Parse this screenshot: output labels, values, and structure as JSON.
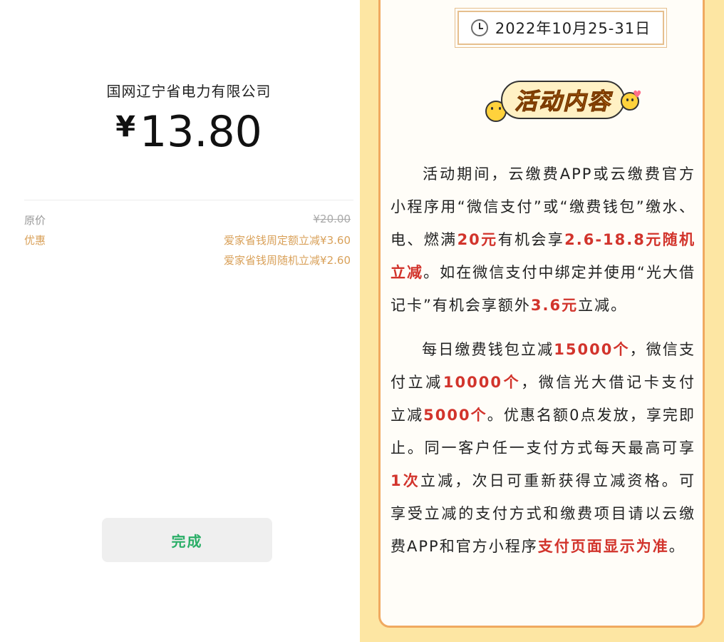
{
  "payment": {
    "merchant": "国网辽宁省电力有限公司",
    "currency_symbol": "¥",
    "amount": "13.80",
    "original_label": "原价",
    "original_value": "¥20.00",
    "discount_label": "优惠",
    "discounts": [
      "爱家省钱周定额立减¥3.60",
      "爱家省钱周随机立减¥2.60"
    ],
    "done_button": "完成"
  },
  "promo": {
    "date": "2022年10月25-31日",
    "badge": "活动内容",
    "p1": {
      "t1": "活动期间，云缴费APP或云缴费官方小程序用“微信支付”或“缴费钱包”缴水、电、燃满",
      "h1": "20元",
      "t2": "有机会享",
      "h2": "2.6-18.8元随机立减",
      "t3": "。如在微信支付中绑定并使用“光大借记卡”有机会享额外",
      "h3": "3.6元",
      "t4": "立减。"
    },
    "p2": {
      "t1": "每日缴费钱包立减",
      "h1": "15000个",
      "t2": "，微信支付立减",
      "h2": "10000个",
      "t3": "，微信光大借记卡支付立减",
      "h3": "5000个",
      "t4": "。优惠名额0点发放，享完即止。同一客户任一支付方式每天最高可享",
      "h4": "1次",
      "t5": "立减，次日可重新获得立减资格。可享受立减的支付方式和缴费项目请以云缴费APP和官方小程序",
      "h5": "支付页面显示为准",
      "t6": "。"
    },
    "colors": {
      "highlight": "#d2342c",
      "background": "#fde6a3",
      "border": "#f0a960"
    }
  }
}
